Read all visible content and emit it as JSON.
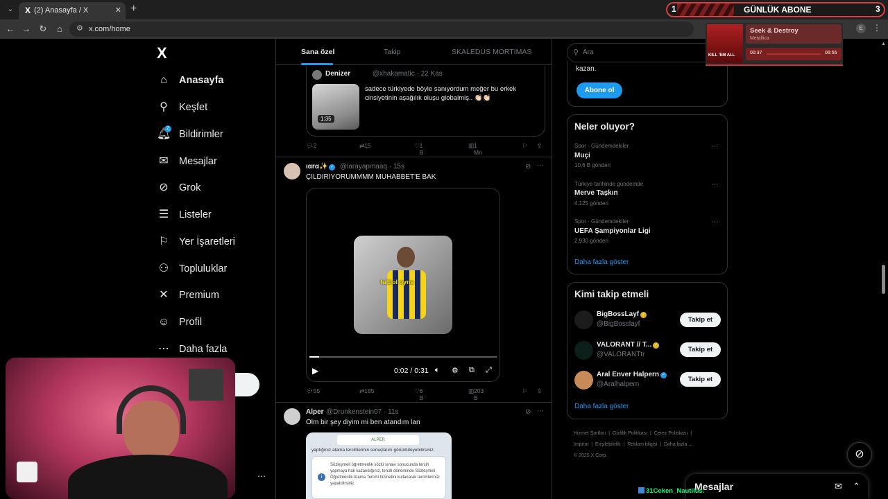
{
  "browser": {
    "tab_title": "(2) Anasayfa / X",
    "tab_favicon": "X",
    "url": "x.com/home",
    "profile_initial": "E"
  },
  "nav": {
    "logo": "X",
    "items": [
      {
        "label": "Anasayfa",
        "icon": "home-icon"
      },
      {
        "label": "Keşfet",
        "icon": "search-icon"
      },
      {
        "label": "Bildirimler",
        "icon": "bell-icon",
        "badge": "2"
      },
      {
        "label": "Mesajlar",
        "icon": "mail-icon"
      },
      {
        "label": "Grok",
        "icon": "grok-icon"
      },
      {
        "label": "Listeler",
        "icon": "list-icon"
      },
      {
        "label": "Yer İşaretleri",
        "icon": "bookmark-icon"
      },
      {
        "label": "Topluluklar",
        "icon": "people-icon"
      },
      {
        "label": "Premium",
        "icon": "x-icon"
      },
      {
        "label": "Profil",
        "icon": "person-icon"
      },
      {
        "label": "Daha fazla",
        "icon": "more-circle-icon"
      }
    ]
  },
  "timeline": {
    "tabs": [
      "Sana özel",
      "Takip",
      "SKALEDUS MORTIMAS"
    ],
    "quote": {
      "name": "Denizer",
      "handle": "@xhakamatic · 22 Kas",
      "duration": "1:35",
      "text": "sadece türkiyede böyle sanıyordum meğer bu erkek cinsiyetinin aşağılık oluşu globalmiş.. 👏🏻👏🏻"
    },
    "actions_1": {
      "replies": "2",
      "reposts": "15",
      "likes": "1 B",
      "views": "1 Mn"
    },
    "tweet_2": {
      "name": "ιαrα✨",
      "handle": "@larayapmaaq · 15s",
      "text": "ÇILDIRIYORUMMMM MUHABBET'E BAK",
      "video_caption": "futbol oyna",
      "video_time": "0:02 / 0:31",
      "video_progress": 0.05
    },
    "actions_2": {
      "replies": "55",
      "reposts": "185",
      "likes": "6 B",
      "views": "203 B"
    },
    "tweet_3": {
      "name": "Alper",
      "handle": "@Drunkenstein07 · 11s",
      "text": "Olm bir şey diyim mi ben atandım lan",
      "card_header": "ALPER",
      "card_line": "yaptığınız atama tercihlerinin sonuçlarını görüntüleyebilirsiniz.",
      "card_info": "Sözleşmeli öğretmenlik sözlü sınavı sonucunda tercih yapmaya hak kazandığınız, tercih döneminde Sözleşmeli Öğretmenlik Atama Tercihi hizmetini kullanarak tercihlerinizi yapabilirsiniz."
    }
  },
  "sidebar": {
    "search_placeholder": "Ara",
    "premium_text": "kazan.",
    "premium_button": "Abone ol",
    "trends_title": "Neler oluyor?",
    "trends": [
      {
        "category": "Spor · Gündemdekiler",
        "name": "Muçi",
        "count": "10,6 B gönderi"
      },
      {
        "category": "Türkiye tarihinde gündemde",
        "name": "Merve Taşkın",
        "count": "4.125 gönderi"
      },
      {
        "category": "Spor · Gündemdekiler",
        "name": "UEFA Şampiyonlar Ligi",
        "count": "2.930 gönderi"
      }
    ],
    "trends_more": "Daha fazla göster",
    "follow_title": "Kimi takip etmeli",
    "follow": [
      {
        "name": "BigBossLayf",
        "handle": "@BigBosslayf",
        "button": "Takip et",
        "avatar_color": "#1c1c1c",
        "badge_color": "#e2b719"
      },
      {
        "name": "VALORANT // T...",
        "handle": "@VALORANTtr",
        "button": "Takip et",
        "avatar_color": "#0d1f1a",
        "badge_color": "#e2b719"
      },
      {
        "name": "Aral Enver Halpern",
        "handle": "@Aralhalpern",
        "button": "Takip et",
        "avatar_color": "#c98a5a",
        "badge_color": "#1d9bf0"
      }
    ],
    "follow_more": "Daha fazla göster",
    "footer": [
      "Hizmet Şartları",
      "Gizlilik Politikası",
      "Çerez Politikası",
      "Imprint",
      "Erişilebilirlik",
      "Reklam bilgisi",
      "Daha fazla ...",
      "© 2025 X Corp."
    ]
  },
  "dm_drawer": {
    "title": "Mesajlar"
  },
  "overlay": {
    "banner_left": "1",
    "banner_label": "GÜNLÜK ABONE",
    "banner_right": "3",
    "music_song": "Seek & Destroy",
    "music_artist": "Metallica",
    "music_elapsed": "00:37",
    "music_total": "06:55",
    "music_cover_text": "KILL 'EM ALL",
    "chat_user": "31Ceken_Nautilus:"
  },
  "colors": {
    "accent": "#1d9bf0",
    "bg": "#000000",
    "border": "#2f3336",
    "muted": "#71767b"
  }
}
